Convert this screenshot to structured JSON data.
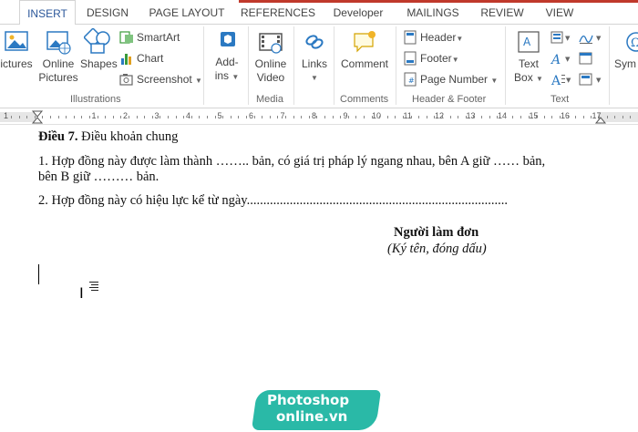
{
  "tabs": [
    "INSERT",
    "DESIGN",
    "PAGE LAYOUT",
    "REFERENCES",
    "Developer",
    "MAILINGS",
    "REVIEW",
    "VIEW"
  ],
  "ribbon": {
    "illustrations": {
      "pictures": "ictures",
      "online_pictures_1": "Online",
      "online_pictures_2": "Pictures",
      "shapes": "Shapes",
      "smartart": "SmartArt",
      "chart": "Chart",
      "screenshot": "Screenshot",
      "label": "Illustrations"
    },
    "addins": {
      "label_1": "Add-",
      "label_2": "ins"
    },
    "media": {
      "online_video_1": "Online",
      "online_video_2": "Video",
      "label": "Media"
    },
    "links": {
      "label": "Links"
    },
    "comments": {
      "comment": "Comment",
      "label": "Comments"
    },
    "header_footer": {
      "header": "Header",
      "footer": "Footer",
      "page_number": "Page Number",
      "label": "Header & Footer"
    },
    "text": {
      "text_box_1": "Text",
      "text_box_2": "Box",
      "label": "Text"
    },
    "symbols": {
      "label": "Sym"
    }
  },
  "ruler": {
    "numbers": [
      "1",
      "1",
      "2",
      "3",
      "4",
      "5",
      "6",
      "7",
      "8",
      "9",
      "10",
      "11",
      "12",
      "13",
      "14",
      "15",
      "16",
      "17"
    ]
  },
  "document": {
    "article_heading": "Điều 7.",
    "article_title": " Điều khoản chung",
    "para1_line1": "1. Hợp đồng này được làm thành …….. bản, có giá trị pháp lý ngang nhau, bên A giữ …… bản,",
    "para1_line2": "bên B giữ ……… bản.",
    "para2": "2. Hợp đồng này có hiệu lực kể từ ngày...............................................................................",
    "signer_title": "Người làm đơn",
    "signer_note": "(Ký tên, đóng dấu)"
  },
  "watermark": {
    "line1": "Photoshop",
    "line2": "online.vn"
  },
  "colors": {
    "accent": "#2b579a",
    "watermark": "#2ab9a7",
    "tab_topline": "#c0392b"
  }
}
